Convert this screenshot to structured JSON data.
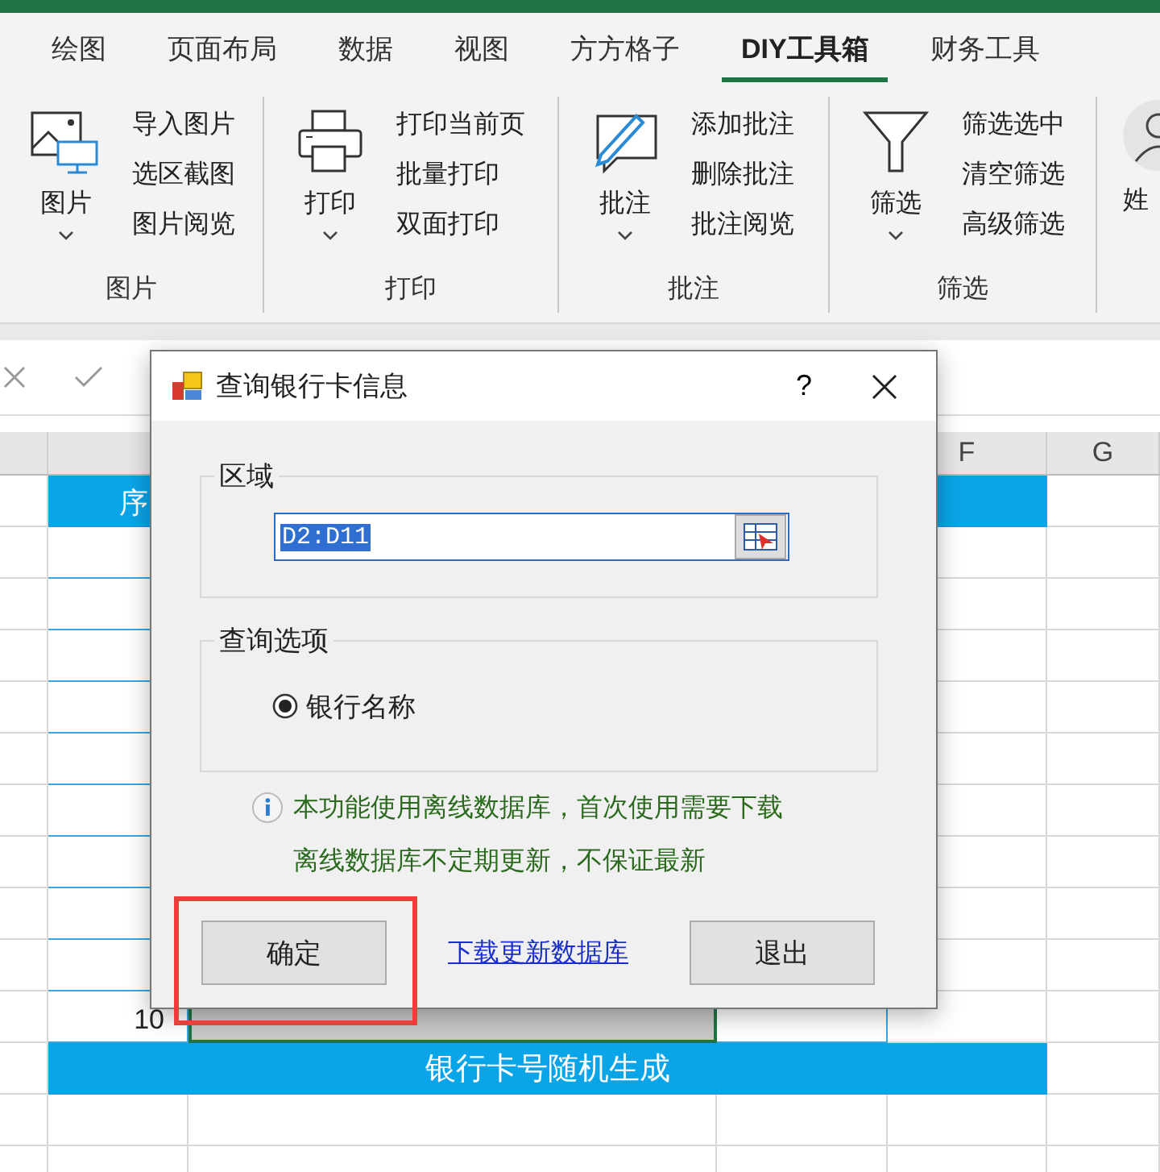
{
  "ribbon": {
    "tabs": [
      {
        "label": "绘图",
        "selected": false
      },
      {
        "label": "页面布局",
        "selected": false
      },
      {
        "label": "数据",
        "selected": false
      },
      {
        "label": "视图",
        "selected": false
      },
      {
        "label": "方方格子",
        "selected": false
      },
      {
        "label": "DIY工具箱",
        "selected": true
      },
      {
        "label": "财务工具",
        "selected": false
      }
    ],
    "groups": [
      {
        "label": "图片",
        "main": "图片",
        "items": [
          "导入图片",
          "选区截图",
          "图片阅览"
        ]
      },
      {
        "label": "打印",
        "main": "打印",
        "items": [
          "打印当前页",
          "批量打印",
          "双面打印"
        ]
      },
      {
        "label": "批注",
        "main": "批注",
        "items": [
          "添加批注",
          "删除批注",
          "批注阅览"
        ]
      },
      {
        "label": "筛选",
        "main": "筛选",
        "items": [
          "筛选选中",
          "清空筛选",
          "高级筛选"
        ]
      }
    ],
    "cut_button": "姓"
  },
  "sheet": {
    "column_headers": [
      "F",
      "G"
    ],
    "table_header": "序",
    "last_row_number": "10",
    "footer": "银行卡号随机生成"
  },
  "dialog": {
    "title": "查询银行卡信息",
    "help": "?",
    "range_group": {
      "label": "区域",
      "value": "D2:D11"
    },
    "options_group": {
      "label": "查询选项",
      "options": [
        {
          "label": "银行名称",
          "selected": true
        }
      ]
    },
    "notes": [
      "本功能使用离线数据库，首次使用需要下载",
      "离线数据库不定期更新，不保证最新"
    ],
    "buttons": [
      {
        "kind": "button",
        "label": "确定",
        "highlighted": true
      },
      {
        "kind": "link",
        "label": "下载更新数据库",
        "highlighted": false
      },
      {
        "kind": "button",
        "label": "退出",
        "highlighted": false
      }
    ]
  }
}
